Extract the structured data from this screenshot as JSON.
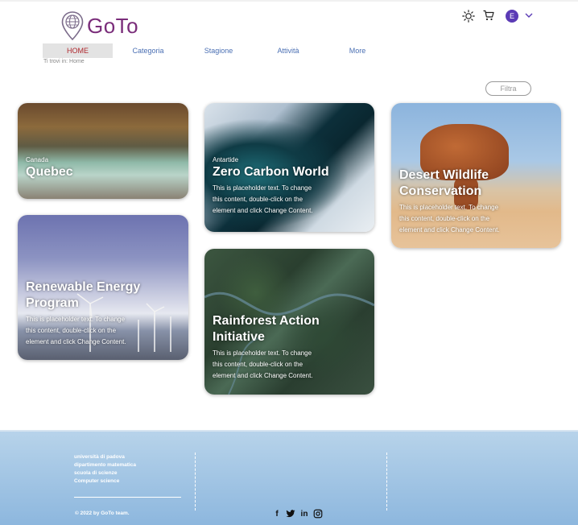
{
  "brand": {
    "name": "GoTo",
    "color": "#7a2d7a"
  },
  "header": {
    "icons": [
      "sun-icon",
      "cart-icon",
      "avatar",
      "chevron-down-icon"
    ],
    "avatar_initial": "E"
  },
  "nav": {
    "items": [
      {
        "label": "HOME",
        "active": true
      },
      {
        "label": "Categoria"
      },
      {
        "label": "Stagione"
      },
      {
        "label": "Attività"
      },
      {
        "label": "More"
      }
    ]
  },
  "breadcrumb": "Ti trovi in: Home",
  "filter_label": "Filtra",
  "cards": [
    {
      "eyebrow": "Canada",
      "title": "Quebec",
      "desc": ""
    },
    {
      "eyebrow": "Antartide",
      "title": "Zero Carbon World",
      "desc": "This is placeholder text. To change this content, double-click on the element and click Change Content."
    },
    {
      "eyebrow": "",
      "title": "Desert Wildlife Conservation",
      "desc": "This is placeholder text. To change this content, double-click on the element and click Change Content."
    },
    {
      "eyebrow": "",
      "title": "Renewable Energy Program",
      "desc": "This is placeholder text. To change this content, double-click on the element and click Change Content."
    },
    {
      "eyebrow": "",
      "title": "Rainforest Action Initiative",
      "desc": "This is placeholder text. To change this content, double-click on the element and click Change Content."
    }
  ],
  "footer": {
    "lines": [
      "università di padova",
      "dipartimento matematica",
      "scuola di scienze",
      "Computer science"
    ],
    "copyright": "© 2022 by GoTo team.",
    "social": [
      "facebook-icon",
      "twitter-icon",
      "linkedin-icon",
      "instagram-icon"
    ]
  }
}
